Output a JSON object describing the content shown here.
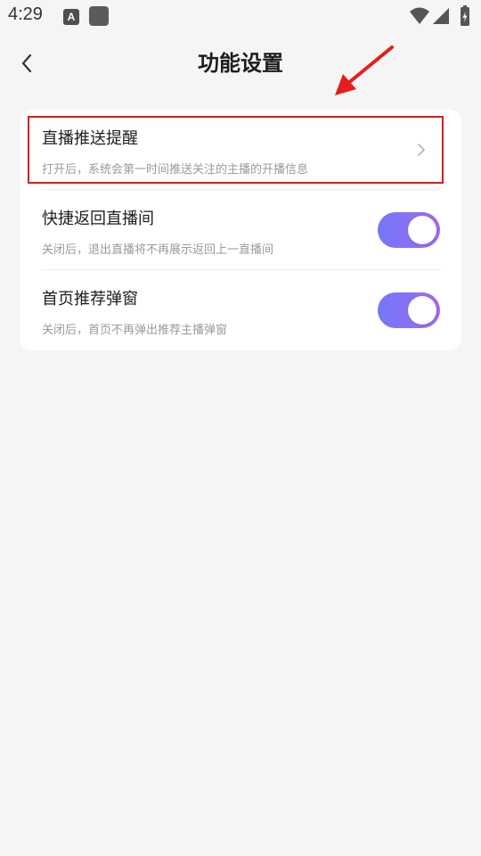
{
  "status_bar": {
    "time": "4:29",
    "notification_icon_letter": "A",
    "icons": {
      "notification": "a-icon",
      "app": "square-icon",
      "wifi": "wifi-icon",
      "signal": "signal-icon",
      "battery": "battery-charging-icon"
    }
  },
  "header": {
    "title": "功能设置",
    "back_icon": "chevron-left-icon"
  },
  "settings": {
    "items": [
      {
        "title": "直播推送提醒",
        "description": "打开后，系统会第一时间推送关注的主播的开播信息",
        "control": "chevron-right-icon"
      },
      {
        "title": "快捷返回直播间",
        "description": "关闭后，退出直播将不再展示返回上一直播间",
        "control": "toggle",
        "enabled": true
      },
      {
        "title": "首页推荐弹窗",
        "description": "关闭后，首页不再弹出推荐主播弹窗",
        "control": "toggle",
        "enabled": true
      }
    ]
  },
  "colors": {
    "background": "#f5f5f5",
    "card": "#ffffff",
    "toggle_start": "#7478f5",
    "toggle_end": "#9d69f4",
    "annotation_red": "#d71d1d",
    "description_text": "#9a9a9a"
  }
}
